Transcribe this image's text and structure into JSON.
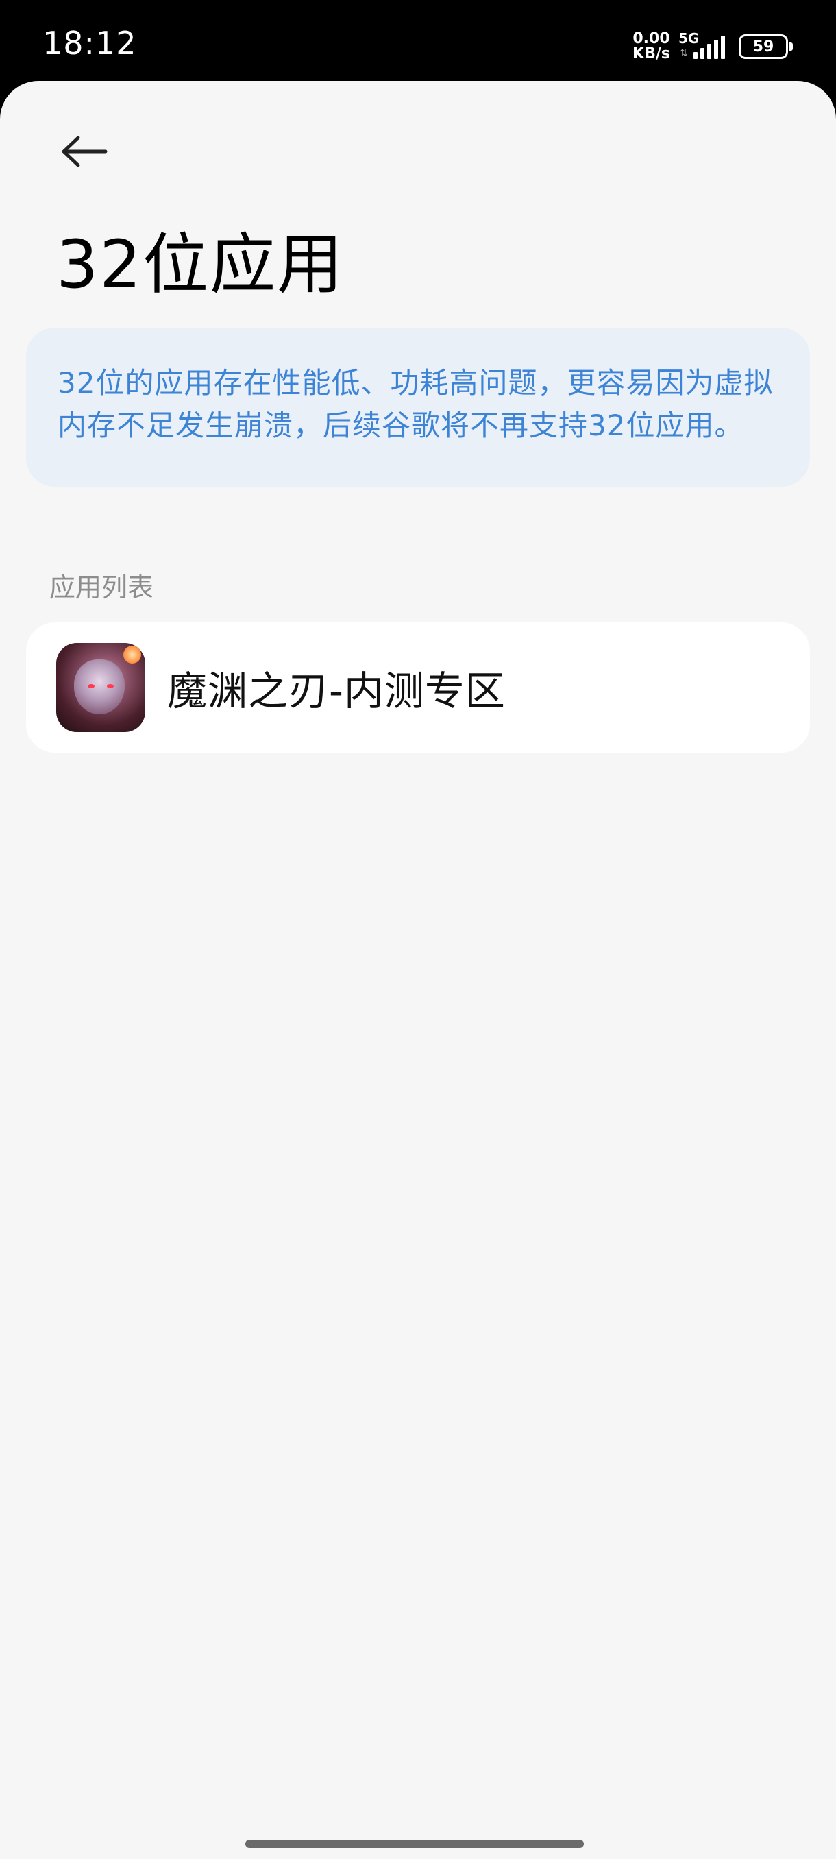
{
  "status_bar": {
    "time": "18:12",
    "net_speed_value": "0.00",
    "net_speed_unit": "KB/s",
    "network_type": "5G",
    "battery": "59"
  },
  "header": {
    "back_icon": "arrow-left-icon",
    "title": "32位应用"
  },
  "info": {
    "text": "32位的应用存在性能低、功耗高问题，更容易因为虚拟内存不足发生崩溃，后续谷歌将不再支持32位应用。"
  },
  "section": {
    "label": "应用列表"
  },
  "apps": [
    {
      "name": "魔渊之刃-内测专区",
      "icon": "app-icon"
    }
  ],
  "colors": {
    "info_text": "#3d84d6",
    "info_bg": "#e9f0f8",
    "page_bg": "#f6f6f6"
  }
}
